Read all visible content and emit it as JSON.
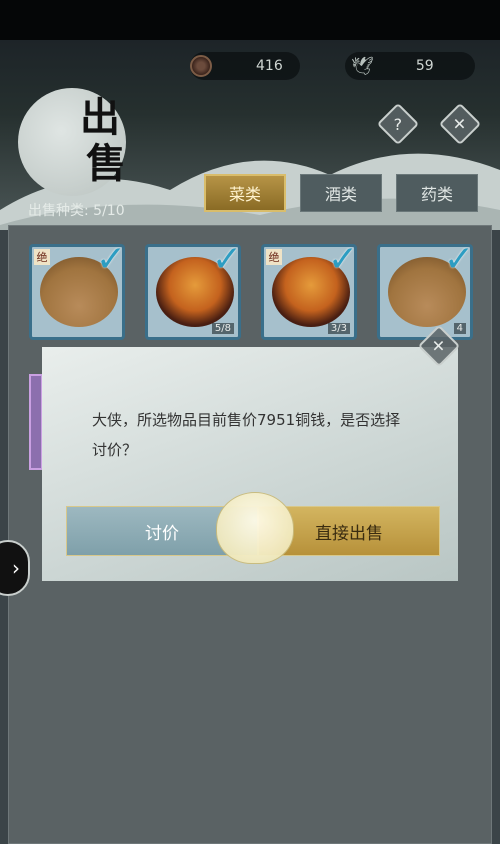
{
  "header": {
    "title_chars": [
      "出",
      "售"
    ],
    "resource_copper_value": "416",
    "resource_second_value": "59",
    "help_label": "?",
    "close_label": "✕"
  },
  "sale": {
    "count_label": "出售种类: 5/10"
  },
  "tabs": [
    {
      "label": "菜类",
      "active": true
    },
    {
      "label": "酒类",
      "active": false
    },
    {
      "label": "药类",
      "active": false
    }
  ],
  "items": [
    {
      "type": "steamed-bun",
      "tag": "绝",
      "count": "",
      "checked": true
    },
    {
      "type": "braised-stew",
      "tag": "",
      "count": "5/8",
      "checked": true
    },
    {
      "type": "braised-stew",
      "tag": "绝",
      "count": "3/3",
      "checked": true
    },
    {
      "type": "steamed-bun",
      "tag": "",
      "count": "4",
      "checked": true
    }
  ],
  "dialog": {
    "message": "大侠，所选物品目前售价7951铜钱，是否选择讨价？",
    "haggle_label": "讨价",
    "sell_direct_label": "直接出售",
    "close_label": "✕"
  },
  "side_arrow_label": "›"
}
